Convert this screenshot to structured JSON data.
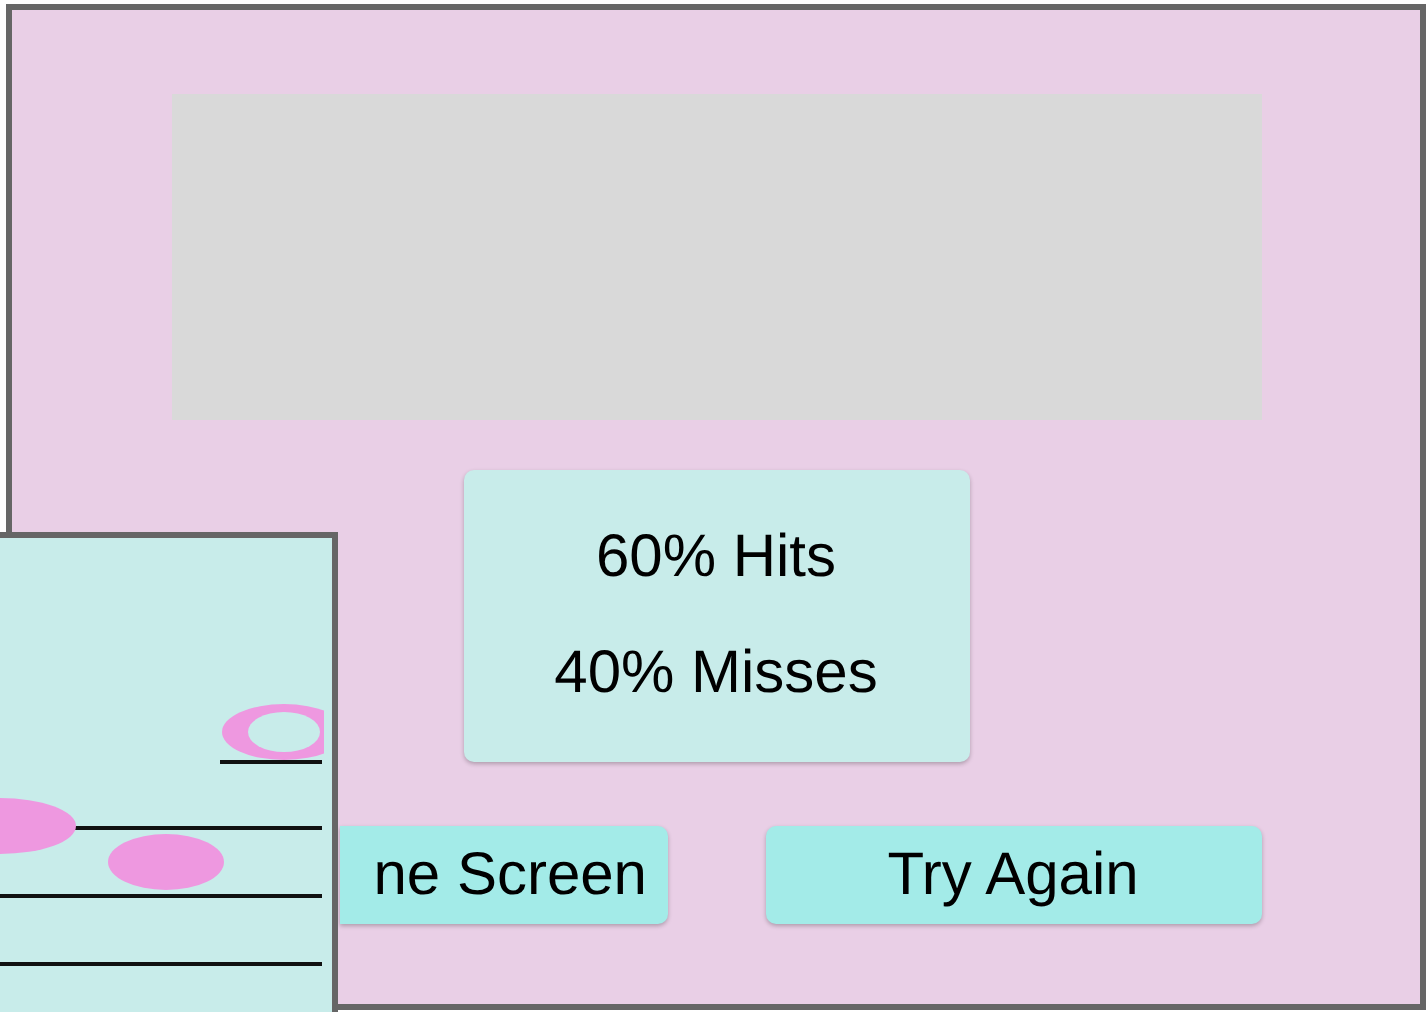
{
  "stats": [
    "60% Hits",
    "40% Misses"
  ],
  "buttons": [
    {
      "label": "ne Screen"
    },
    {
      "label": "Try Again"
    }
  ]
}
